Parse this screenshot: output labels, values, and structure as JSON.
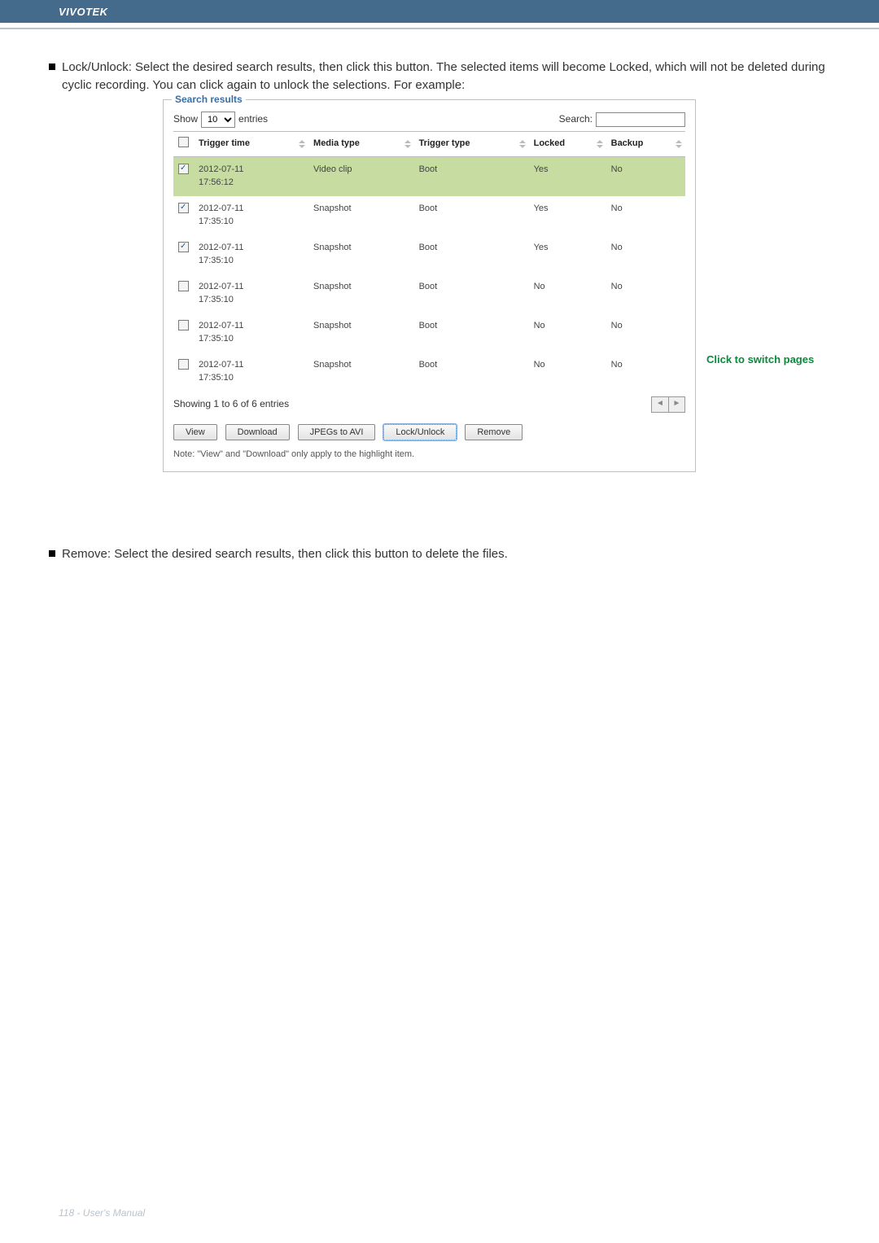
{
  "header": {
    "brand": "VIVOTEK"
  },
  "para1_prefix": "Lock/Unlock: Select the desired search results, then click this button. The selected items will become Locked, which will not be deleted during cyclic recording. You can click again to unlock the selections. For example:",
  "fieldset": {
    "legend": "Search results",
    "show_label_pre": "Show",
    "show_value": "10",
    "show_label_post": "entries",
    "search_label": "Search:",
    "search_value": "",
    "columns": {
      "col_chk": "",
      "col_trigger_time": "Trigger time",
      "col_media_type": "Media type",
      "col_trigger_type": "Trigger type",
      "col_locked": "Locked",
      "col_backup": "Backup"
    },
    "rows": [
      {
        "checked": true,
        "highlight": true,
        "trigger_time": "2012-07-11 17:56:12",
        "media_type": "Video clip",
        "trigger_type": "Boot",
        "locked": "Yes",
        "backup": "No"
      },
      {
        "checked": true,
        "highlight": false,
        "trigger_time": "2012-07-11 17:35:10",
        "media_type": "Snapshot",
        "trigger_type": "Boot",
        "locked": "Yes",
        "backup": "No"
      },
      {
        "checked": true,
        "highlight": false,
        "trigger_time": "2012-07-11 17:35:10",
        "media_type": "Snapshot",
        "trigger_type": "Boot",
        "locked": "Yes",
        "backup": "No"
      },
      {
        "checked": false,
        "highlight": false,
        "trigger_time": "2012-07-11 17:35:10",
        "media_type": "Snapshot",
        "trigger_type": "Boot",
        "locked": "No",
        "backup": "No"
      },
      {
        "checked": false,
        "highlight": false,
        "trigger_time": "2012-07-11 17:35:10",
        "media_type": "Snapshot",
        "trigger_type": "Boot",
        "locked": "No",
        "backup": "No"
      },
      {
        "checked": false,
        "highlight": false,
        "trigger_time": "2012-07-11 17:35:10",
        "media_type": "Snapshot",
        "trigger_type": "Boot",
        "locked": "No",
        "backup": "No"
      }
    ],
    "showing_text": "Showing 1 to 6 of 6 entries",
    "buttons": {
      "view": "View",
      "download": "Download",
      "jpegs_to_avi": "JPEGs to AVI",
      "lock_unlock": "Lock/Unlock",
      "remove": "Remove"
    },
    "note": "Note: \"View\" and \"Download\" only apply to the highlight item."
  },
  "side_label": "Click to switch pages",
  "para2": "Remove: Select the desired search results, then click this button to delete the files.",
  "footer": "118 - User's Manual"
}
